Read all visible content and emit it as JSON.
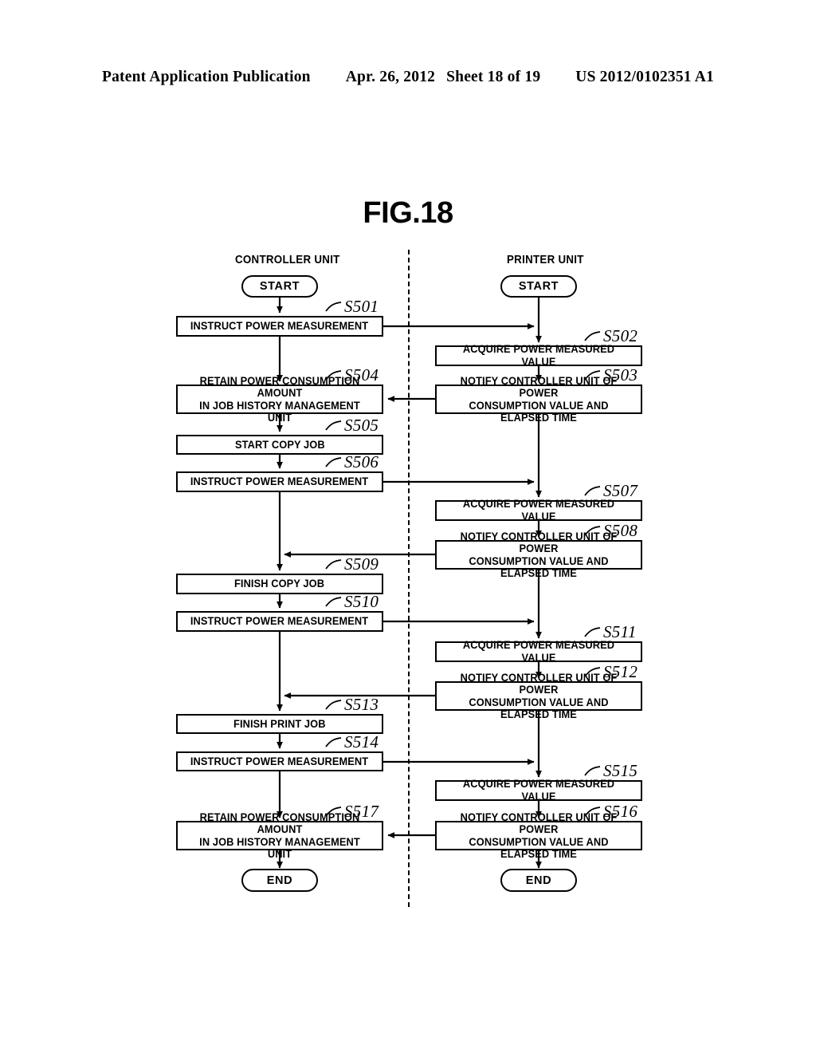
{
  "header": {
    "publication": "Patent Application Publication",
    "date": "Apr. 26, 2012",
    "sheet": "Sheet 18 of 19",
    "docnum": "US 2012/0102351 A1"
  },
  "figure": {
    "title": "FIG.18"
  },
  "lanes": [
    {
      "id": "controller",
      "label": "CONTROLLER UNIT"
    },
    {
      "id": "printer",
      "label": "PRINTER UNIT"
    }
  ],
  "terminators": {
    "controller_start": "START",
    "printer_start": "START",
    "controller_end": "END",
    "printer_end": "END"
  },
  "steps": [
    {
      "id": "S501",
      "lane": "controller",
      "label": "S501",
      "text": "INSTRUCT POWER MEASUREMENT"
    },
    {
      "id": "S502",
      "lane": "printer",
      "label": "S502",
      "text": "ACQUIRE POWER MEASURED VALUE"
    },
    {
      "id": "S503",
      "lane": "printer",
      "label": "S503",
      "line1": "NOTIFY CONTROLLER UNIT OF POWER",
      "line2": "CONSUMPTION VALUE AND ELAPSED TIME"
    },
    {
      "id": "S504",
      "lane": "controller",
      "label": "S504",
      "line1": "RETAIN POWER CONSUMPTION AMOUNT",
      "line2": "IN JOB HISTORY MANAGEMENT UNIT"
    },
    {
      "id": "S505",
      "lane": "controller",
      "label": "S505",
      "text": "START COPY JOB"
    },
    {
      "id": "S506",
      "lane": "controller",
      "label": "S506",
      "text": "INSTRUCT POWER MEASUREMENT"
    },
    {
      "id": "S507",
      "lane": "printer",
      "label": "S507",
      "text": "ACQUIRE POWER MEASURED VALUE"
    },
    {
      "id": "S508",
      "lane": "printer",
      "label": "S508",
      "line1": "NOTIFY CONTROLLER UNIT OF POWER",
      "line2": "CONSUMPTION VALUE AND ELAPSED TIME"
    },
    {
      "id": "S509",
      "lane": "controller",
      "label": "S509",
      "text": "FINISH COPY JOB"
    },
    {
      "id": "S510",
      "lane": "controller",
      "label": "S510",
      "text": "INSTRUCT POWER MEASUREMENT"
    },
    {
      "id": "S511",
      "lane": "printer",
      "label": "S511",
      "text": "ACQUIRE POWER MEASURED VALUE"
    },
    {
      "id": "S512",
      "lane": "printer",
      "label": "S512",
      "line1": "NOTIFY CONTROLLER UNIT OF POWER",
      "line2": "CONSUMPTION VALUE AND ELAPSED TIME"
    },
    {
      "id": "S513",
      "lane": "controller",
      "label": "S513",
      "text": "FINISH PRINT JOB"
    },
    {
      "id": "S514",
      "lane": "controller",
      "label": "S514",
      "text": "INSTRUCT POWER MEASUREMENT"
    },
    {
      "id": "S515",
      "lane": "printer",
      "label": "S515",
      "text": "ACQUIRE POWER MEASURED VALUE"
    },
    {
      "id": "S516",
      "lane": "printer",
      "label": "S516",
      "line1": "NOTIFY CONTROLLER UNIT OF POWER",
      "line2": "CONSUMPTION VALUE AND ELAPSED TIME"
    },
    {
      "id": "S517",
      "lane": "controller",
      "label": "S517",
      "line1": "RETAIN POWER CONSUMPTION AMOUNT",
      "line2": "IN JOB HISTORY MANAGEMENT UNIT"
    }
  ],
  "colors": {
    "ink": "#000000",
    "paper": "#ffffff"
  }
}
